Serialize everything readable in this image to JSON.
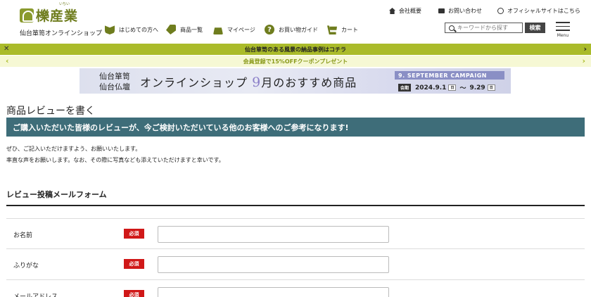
{
  "header": {
    "logo_text": "櫟産業",
    "logo_ruby": "いちい",
    "tagline": "仙台箪笥オンラインショップ",
    "utility_links": [
      {
        "label": "会社概要",
        "icon": "building-icon"
      },
      {
        "label": "お問い合わせ",
        "icon": "mail-icon"
      },
      {
        "label": "オフィシャルサイトはこちら",
        "icon": "globe-icon"
      }
    ],
    "nav": [
      {
        "label": "はじめての方へ",
        "icon": "leaf-icon"
      },
      {
        "label": "商品一覧",
        "icon": "tag-icon"
      },
      {
        "label": "マイページ",
        "icon": "bag-icon"
      },
      {
        "label": "お買い物ガイド",
        "icon": "help-icon",
        "glyph": "?"
      },
      {
        "label": "カート",
        "icon": "cart-icon"
      }
    ],
    "search": {
      "placeholder": "キーワードから探す",
      "value": "",
      "button": "検索"
    },
    "menu_label": "Menu"
  },
  "notice": {
    "text": "仙台箪笥のある風景の納品事例はコチラ",
    "close_glyph": "✕",
    "arrow_glyph": "›"
  },
  "promo": {
    "text": "会員登録で15%OFFクーポンプレゼント",
    "prev_glyph": "‹",
    "next_glyph": "›"
  },
  "campaign": {
    "brand_line1": "仙台箪笥",
    "brand_line2": "仙台仏壇",
    "title_pre": "オンラインショップ ",
    "title_num": "9",
    "title_post": "月のおすすめ商品",
    "badge": "9. SEPTEMBER CAMPAIGN",
    "period_label": "会期",
    "start": "2024.9.1",
    "start_day": "日",
    "tilde": "～",
    "end": "9.29",
    "end_day": "日"
  },
  "main": {
    "page_title": "商品レビューを書く",
    "lead": "ご購入いただいた皆様のレビューが、今ご検討いただいている他のお客様へのご参考になります!",
    "intro_line1": "ぜひ、ご記入いただけますよう、お願いいたします。",
    "intro_line2": "率直な声をお願いします。なお、その際に写真なども添えていただけますと幸いです。",
    "form_title": "レビュー投稿メールフォーム",
    "required_label": "必須",
    "fields": [
      {
        "label": "お名前",
        "value": ""
      },
      {
        "label": "ふりがな",
        "value": ""
      },
      {
        "label": "メールアドレス",
        "value": ""
      }
    ]
  },
  "colors": {
    "brand_olive": "#6f7d1e",
    "notice_bg": "#aabb2a",
    "lead_bar": "#3e6d79",
    "required": "#d01818"
  }
}
